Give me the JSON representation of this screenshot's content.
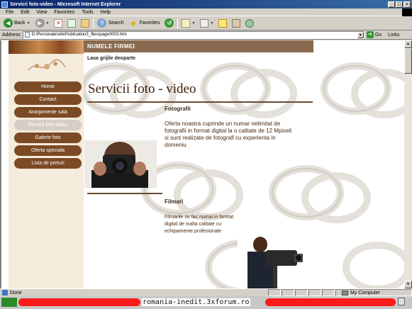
{
  "window": {
    "title": "Servicii foto-video - Microsoft Internet Explorer",
    "buttons": [
      "_",
      "□",
      "×"
    ]
  },
  "menu": [
    "File",
    "Edit",
    "View",
    "Favorites",
    "Tools",
    "Help"
  ],
  "toolbar": {
    "back_label": "Back",
    "search_label": "Search",
    "favorites_label": "Favorites"
  },
  "address": {
    "label": "Address",
    "value": "D:\\Personale\\site\\Publication3_files\\page0003.htm",
    "go_label": "Go",
    "links_label": "Links"
  },
  "page": {
    "brand": "NUMELE FIRMEI",
    "tagline": "Lasa grijile deoparte",
    "title": "Servicii foto - video",
    "nav": [
      "Home",
      "Contact",
      "Aranjamente sala",
      "Servicii foto-video",
      "Galerie foto",
      "Oferta speciala",
      "Lista de preturi"
    ],
    "nav_active_index": 3,
    "sections": [
      {
        "title": "Fotografii",
        "text": [
          "Oferta noastra cuprinde un numar nelimitat de",
          "fotografii in format digital la o calitate de 12 Mpixeli",
          "si sunt realizate de fotografi cu experienta in",
          "domeniu"
        ]
      },
      {
        "title": "Filmari",
        "text": [
          "Filmarile se fac numai in format",
          "digital de inalta calitate cu",
          "echipamente profesionale"
        ]
      }
    ]
  },
  "status": {
    "text": "Done",
    "zone": "My Computer"
  },
  "watermark": "romania-inedit.3xforum.ro",
  "colors": {
    "nav_button": "#7b4a24",
    "nav_active": "#d6cec4",
    "banner": "#8a6a4e",
    "title_text": "#3b1d08"
  }
}
